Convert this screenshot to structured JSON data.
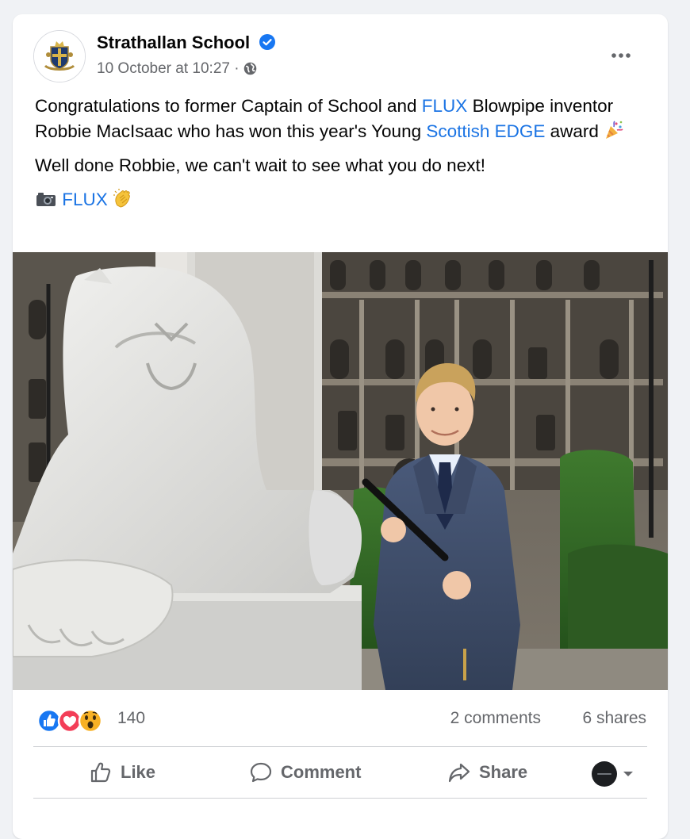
{
  "post": {
    "page_name": "Strathallan School",
    "timestamp": "10 October at 10:27",
    "meta_separator": " · ",
    "text": {
      "line1_a": "Congratulations to former Captain of School and ",
      "line1_link": "FLUX",
      "line1_b": " Blowpipe inventor Robbie MacIsaac who has won this year's Young ",
      "line1_link2": "Scottish EDGE",
      "line1_c": " award",
      "line2": "Well done Robbie, we can't wait to see what you do next!",
      "line3_link": "FLUX"
    },
    "icons": {
      "verified": "verified-badge-icon",
      "privacy": "globe-icon",
      "more": "more-options-icon",
      "party": "party-popper-emoji",
      "camera": "camera-emoji",
      "clap": "clapping-hands-emoji"
    }
  },
  "stats": {
    "reactions": [
      "like",
      "love",
      "wow"
    ],
    "reaction_count": "140",
    "comments": "2 comments",
    "shares": "6 shares"
  },
  "actions": {
    "like": "Like",
    "comment": "Comment",
    "share": "Share"
  },
  "colors": {
    "link": "#1b74e4",
    "like_blue": "#1877f2",
    "love_red": "#f33e58",
    "wow_yellow": "#f7b125",
    "muted": "#65676b"
  }
}
